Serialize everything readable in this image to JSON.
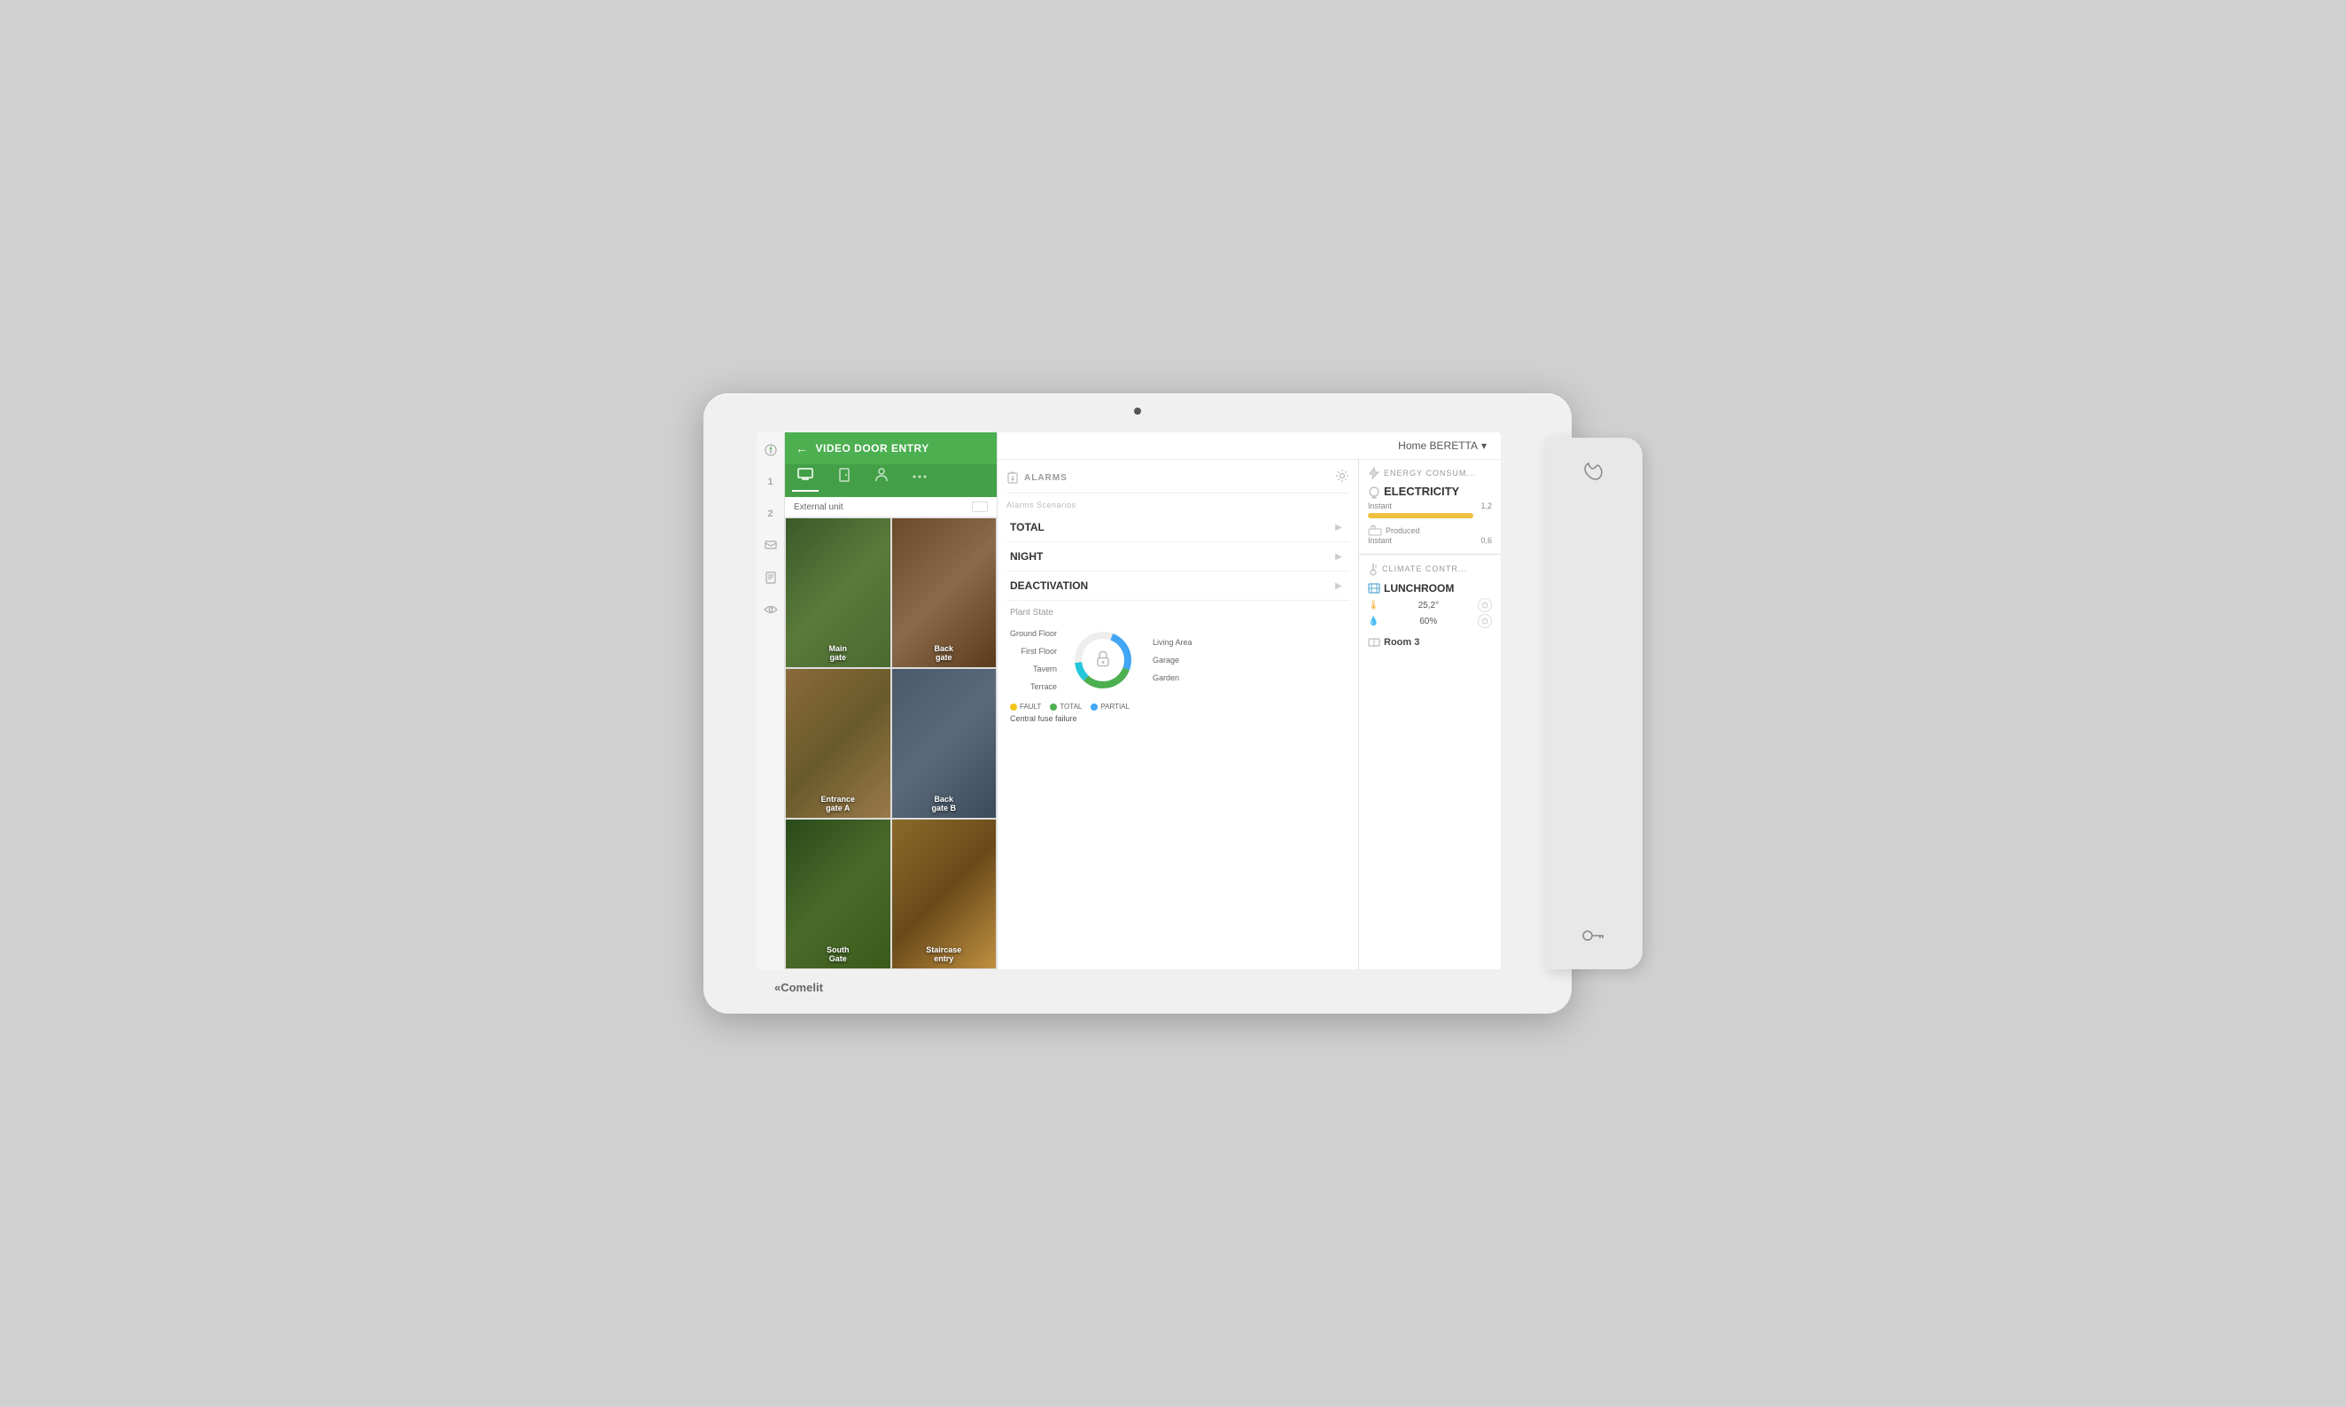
{
  "device": {
    "brand": "Comelit",
    "brand_symbol": "«Comelit"
  },
  "vde": {
    "title": "VIDEO DOOR ENTRY",
    "tabs": [
      "monitor-icon",
      "door-icon",
      "person-icon",
      "more-icon"
    ],
    "external_unit_label": "External unit",
    "cameras": [
      {
        "id": "main-gate",
        "label": "Main\ngate",
        "style": "cam-green"
      },
      {
        "id": "back-gate1",
        "label": "Back\ngate",
        "style": "cam-brown"
      },
      {
        "id": "entrance-gate-a",
        "label": "Entrance\ngate A",
        "style": "cam-wood"
      },
      {
        "id": "back-gate-b",
        "label": "Back\ngate B",
        "style": "cam-metal"
      },
      {
        "id": "south-gate",
        "label": "South\nGate",
        "style": "cam-garden"
      },
      {
        "id": "staircase-entry",
        "label": "Staircase\nentry",
        "style": "cam-door"
      }
    ]
  },
  "header": {
    "home_label": "Home BERETTA",
    "dropdown_icon": "▾"
  },
  "alarms": {
    "title": "ALARMS",
    "scenarios_label": "Alarms Scenarios",
    "scenarios": [
      {
        "name": "TOTAL"
      },
      {
        "name": "NIGHT"
      },
      {
        "name": "DEACTIVATION"
      }
    ]
  },
  "plant_state": {
    "title": "Plant State",
    "floors_left": [
      "Ground Floor",
      "First Floor",
      "Tavern",
      "Terrace"
    ],
    "floors_right": [
      "Living Area",
      "Garage",
      "Garden"
    ],
    "legend": [
      {
        "label": "FAULT",
        "color": "#f5c518"
      },
      {
        "label": "TOTAL",
        "color": "#4caf50"
      },
      {
        "label": "PARTIAL",
        "color": "#42a5f5"
      }
    ],
    "fault_message": "Central fuse failure"
  },
  "energy": {
    "title": "ENERGY CONSUM...",
    "electricity_label": "ELECTRICITY",
    "instant_label": "Instant",
    "instant_value": "1,2",
    "produced_label": "Produced",
    "produced_instant_label": "Instant",
    "produced_instant_value": "0,6",
    "bar_width": "85%"
  },
  "climate": {
    "title": "CLIMATE CONTR...",
    "rooms": [
      {
        "name": "LUNCHROOM",
        "temperature": "25,2°",
        "humidity": "60%",
        "has_controls": true
      }
    ],
    "room3_label": "Room 3"
  },
  "nav_icons": [
    "compass-icon",
    "num1-icon",
    "num2-icon",
    "message-icon",
    "document-icon",
    "eye-icon"
  ],
  "side_panel": {
    "top_icon": "phone-icon",
    "bottom_icon": "key-icon"
  }
}
